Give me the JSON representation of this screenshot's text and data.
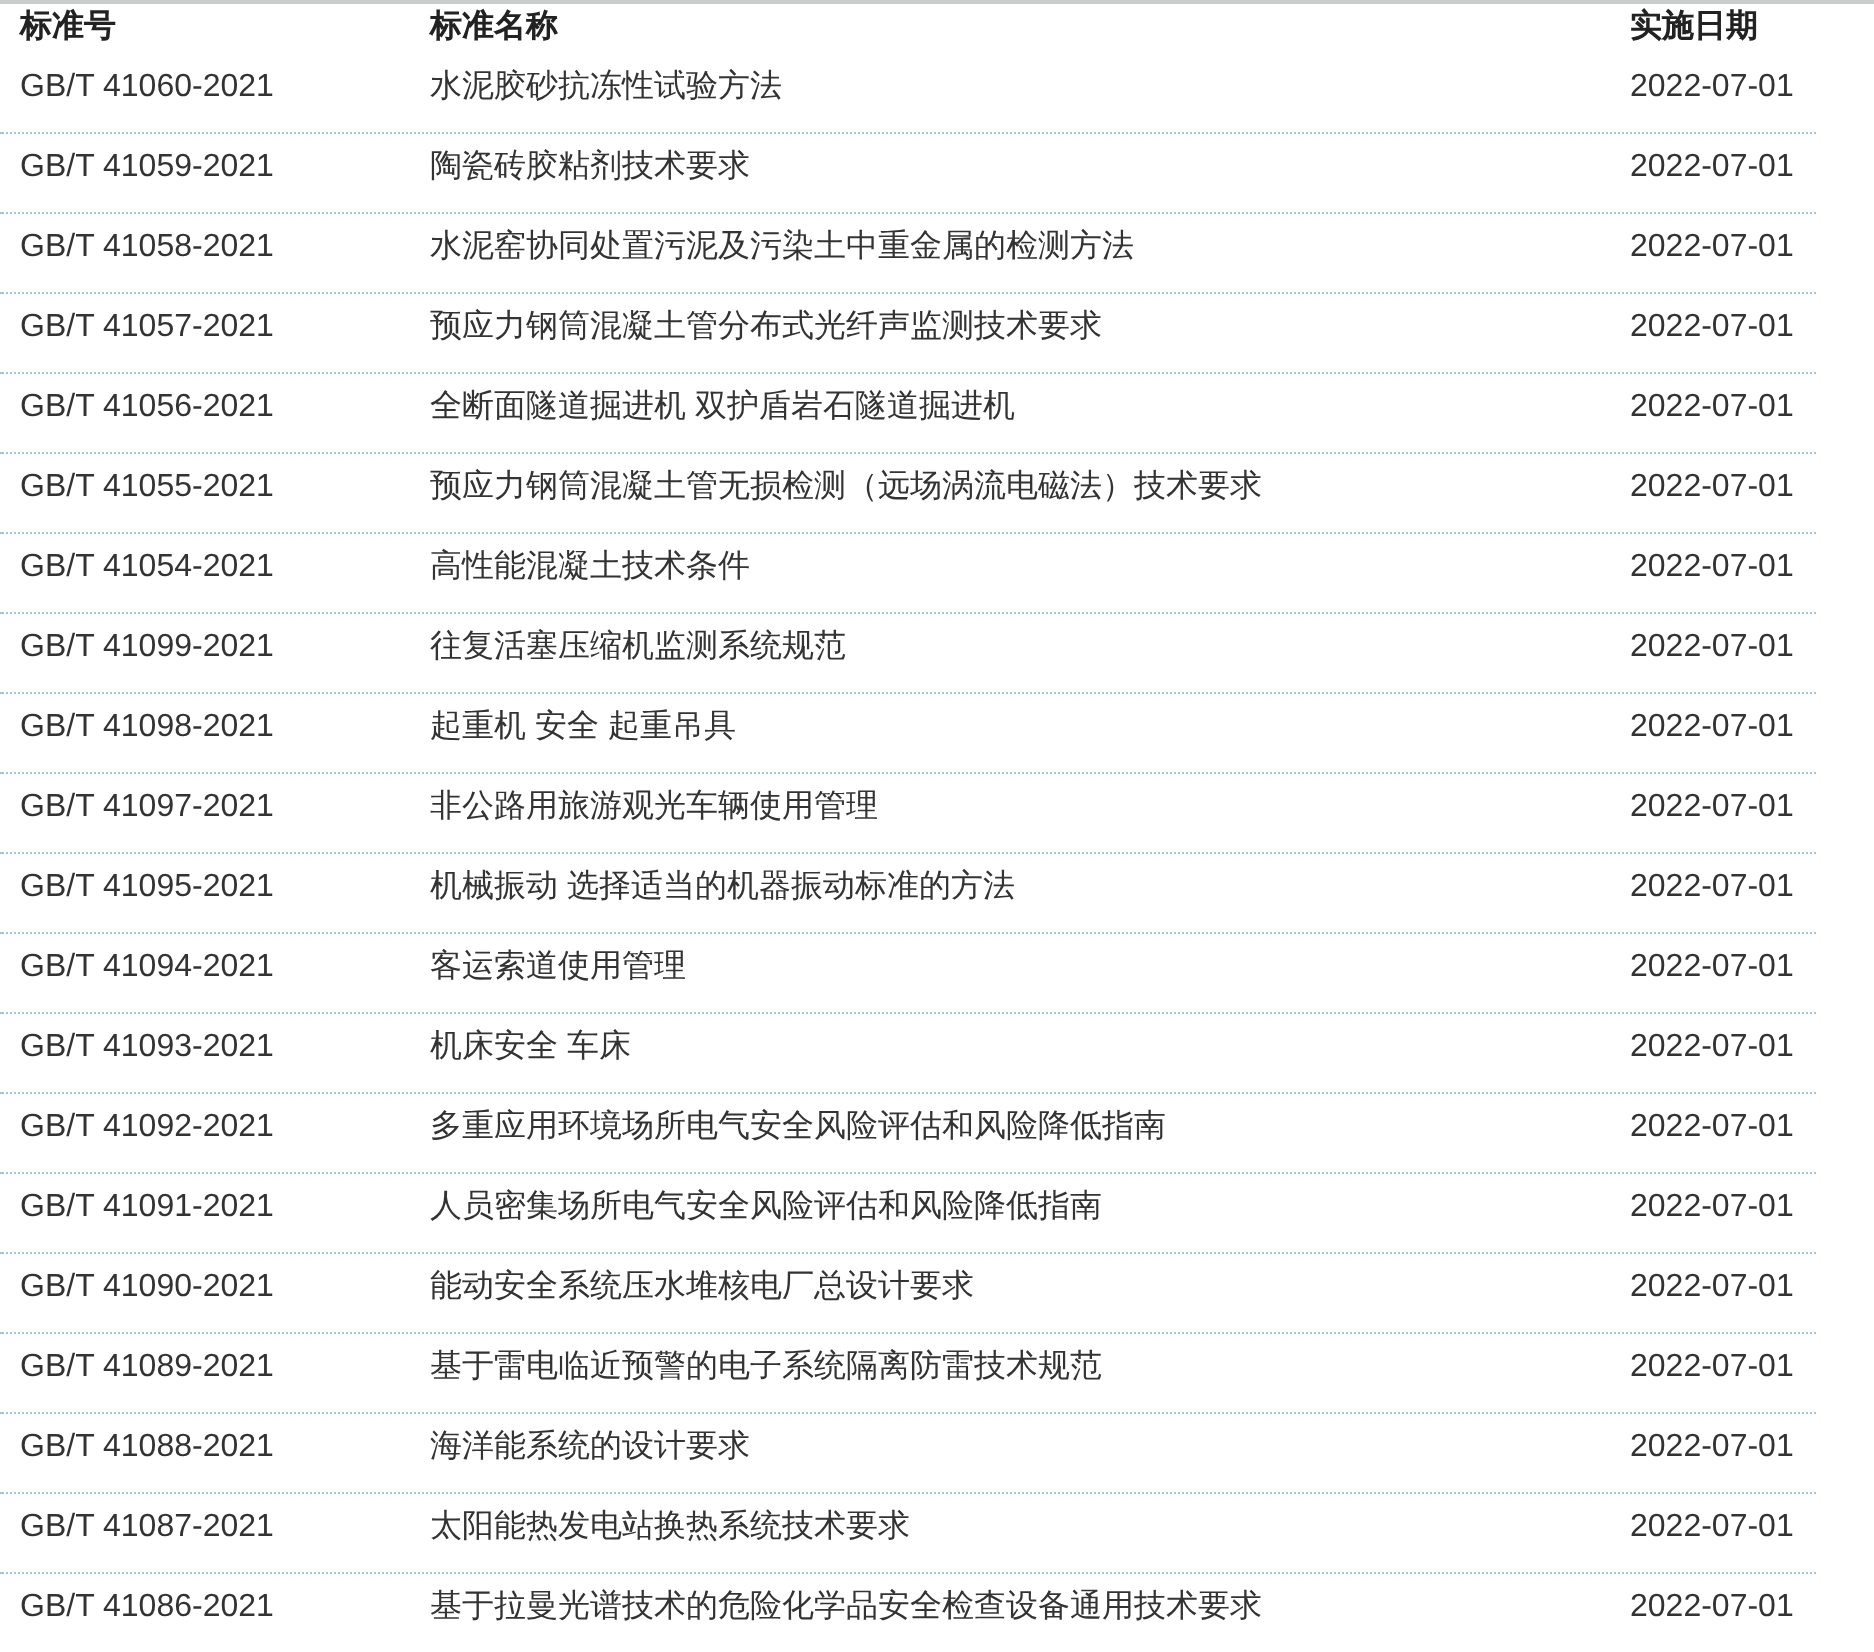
{
  "table": {
    "columns": [
      "标准号",
      "标准名称",
      "实施日期"
    ],
    "rows": [
      {
        "code": "GB/T 41060-2021",
        "name": "水泥胶砂抗冻性试验方法",
        "date": "2022-07-01"
      },
      {
        "code": "GB/T 41059-2021",
        "name": "陶瓷砖胶粘剂技术要求",
        "date": "2022-07-01"
      },
      {
        "code": "GB/T 41058-2021",
        "name": "水泥窑协同处置污泥及污染土中重金属的检测方法",
        "date": "2022-07-01"
      },
      {
        "code": "GB/T 41057-2021",
        "name": "预应力钢筒混凝土管分布式光纤声监测技术要求",
        "date": "2022-07-01"
      },
      {
        "code": "GB/T 41056-2021",
        "name": "全断面隧道掘进机 双护盾岩石隧道掘进机",
        "date": "2022-07-01"
      },
      {
        "code": "GB/T 41055-2021",
        "name": "预应力钢筒混凝土管无损检测（远场涡流电磁法）技术要求",
        "date": "2022-07-01"
      },
      {
        "code": "GB/T 41054-2021",
        "name": "高性能混凝土技术条件",
        "date": "2022-07-01"
      },
      {
        "code": "GB/T 41099-2021",
        "name": "往复活塞压缩机监测系统规范",
        "date": "2022-07-01"
      },
      {
        "code": "GB/T 41098-2021",
        "name": "起重机 安全 起重吊具",
        "date": "2022-07-01"
      },
      {
        "code": "GB/T 41097-2021",
        "name": "非公路用旅游观光车辆使用管理",
        "date": "2022-07-01"
      },
      {
        "code": "GB/T 41095-2021",
        "name": "机械振动 选择适当的机器振动标准的方法",
        "date": "2022-07-01"
      },
      {
        "code": "GB/T 41094-2021",
        "name": "客运索道使用管理",
        "date": "2022-07-01"
      },
      {
        "code": "GB/T 41093-2021",
        "name": "机床安全 车床",
        "date": "2022-07-01"
      },
      {
        "code": "GB/T 41092-2021",
        "name": "多重应用环境场所电气安全风险评估和风险降低指南",
        "date": "2022-07-01"
      },
      {
        "code": "GB/T 41091-2021",
        "name": "人员密集场所电气安全风险评估和风险降低指南",
        "date": "2022-07-01"
      },
      {
        "code": "GB/T 41090-2021",
        "name": "能动安全系统压水堆核电厂总设计要求",
        "date": "2022-07-01"
      },
      {
        "code": "GB/T 41089-2021",
        "name": "基于雷电临近预警的电子系统隔离防雷技术规范",
        "date": "2022-07-01"
      },
      {
        "code": "GB/T 41088-2021",
        "name": "海洋能系统的设计要求",
        "date": "2022-07-01"
      },
      {
        "code": "GB/T 41087-2021",
        "name": "太阳能热发电站换热系统技术要求",
        "date": "2022-07-01"
      },
      {
        "code": "GB/T 41086-2021",
        "name": "基于拉曼光谱技术的危险化学品安全检查设备通用技术要求",
        "date": "2022-07-01"
      }
    ]
  }
}
